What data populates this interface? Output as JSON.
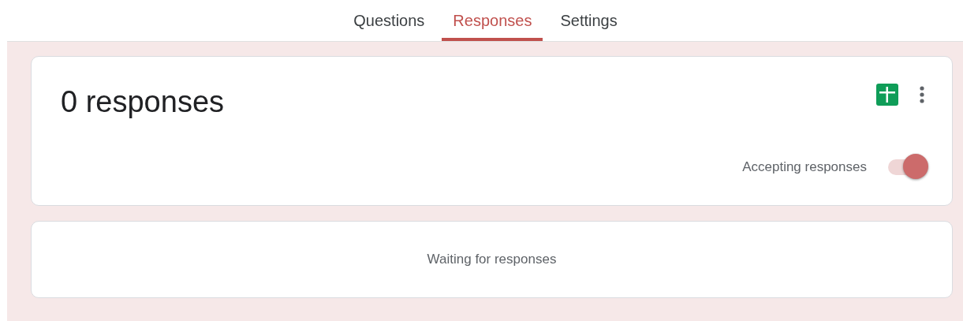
{
  "tabs": [
    {
      "label": "Questions",
      "selected": false
    },
    {
      "label": "Responses",
      "selected": true
    },
    {
      "label": "Settings",
      "selected": false
    }
  ],
  "summary": {
    "title": "0 responses",
    "accepting": {
      "label": "Accepting responses",
      "on": true
    }
  },
  "empty_state": {
    "message": "Waiting for responses"
  }
}
